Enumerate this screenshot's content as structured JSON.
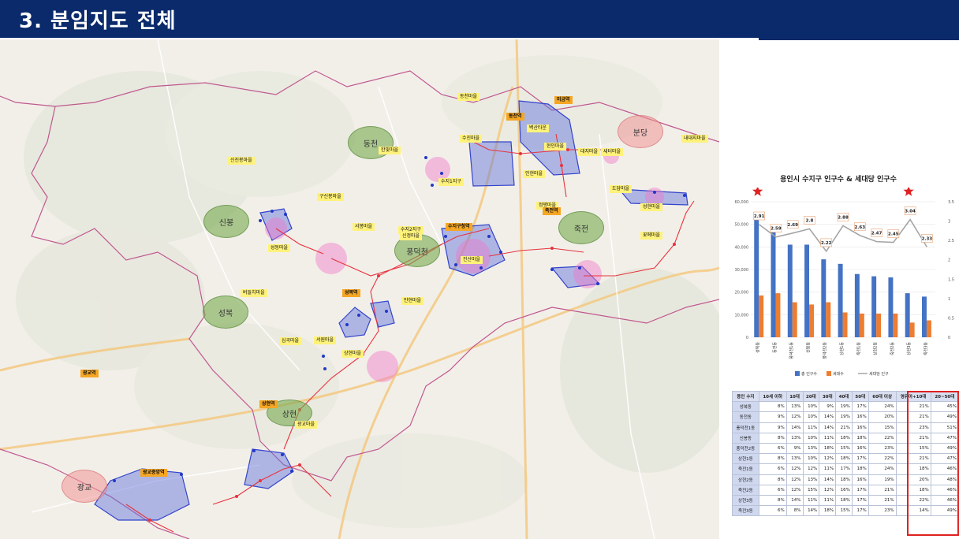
{
  "header": {
    "title": "3. 분임지도 전체"
  },
  "map": {
    "regions": [
      {
        "label": "동천",
        "color": "green"
      },
      {
        "label": "신봉",
        "color": "green"
      },
      {
        "label": "풍덕천",
        "color": "green"
      },
      {
        "label": "죽전",
        "color": "green"
      },
      {
        "label": "성복",
        "color": "green"
      },
      {
        "label": "상현",
        "color": "green"
      },
      {
        "label": "분당",
        "color": "pink"
      },
      {
        "label": "광교",
        "color": "pink"
      }
    ],
    "tags": [
      {
        "text": "동천마을",
        "style": "yellow"
      },
      {
        "text": "동천역",
        "style": "orange"
      },
      {
        "text": "미금역",
        "style": "orange"
      },
      {
        "text": "수진마을",
        "style": "yellow"
      },
      {
        "text": "한빛마을",
        "style": "yellow"
      },
      {
        "text": "벽산타운",
        "style": "yellow"
      },
      {
        "text": "현인마을",
        "style": "yellow"
      },
      {
        "text": "대지마을",
        "style": "yellow"
      },
      {
        "text": "내대지마을",
        "style": "yellow"
      },
      {
        "text": "새터마을",
        "style": "yellow"
      },
      {
        "text": "인현마을",
        "style": "yellow"
      },
      {
        "text": "도담마을",
        "style": "yellow"
      },
      {
        "text": "신진봉마을",
        "style": "yellow"
      },
      {
        "text": "구신봉마을",
        "style": "yellow"
      },
      {
        "text": "수지1지구",
        "style": "yellow"
      },
      {
        "text": "정평마을",
        "style": "yellow"
      },
      {
        "text": "죽전역",
        "style": "orange"
      },
      {
        "text": "성현마을",
        "style": "yellow"
      },
      {
        "text": "꽃메마을",
        "style": "yellow"
      },
      {
        "text": "서봉마을",
        "style": "yellow"
      },
      {
        "text": "수지2지구",
        "style": "yellow"
      },
      {
        "text": "신정마을",
        "style": "yellow"
      },
      {
        "text": "수지구청역",
        "style": "orange"
      },
      {
        "text": "진산마을",
        "style": "yellow"
      },
      {
        "text": "성동마을",
        "style": "yellow"
      },
      {
        "text": "버들치마을",
        "style": "yellow"
      },
      {
        "text": "성복역",
        "style": "orange"
      },
      {
        "text": "만현마을",
        "style": "yellow"
      },
      {
        "text": "심곡마을",
        "style": "yellow"
      },
      {
        "text": "서원마을",
        "style": "yellow"
      },
      {
        "text": "상현마을",
        "style": "yellow"
      },
      {
        "text": "광교역",
        "style": "orange"
      },
      {
        "text": "상현역",
        "style": "orange"
      },
      {
        "text": "광교마을",
        "style": "yellow"
      },
      {
        "text": "광교중앙역",
        "style": "orange"
      }
    ]
  },
  "chart_data": {
    "type": "bar",
    "title": "용인시 수지구 인구수 & 세대당 인구수",
    "categories": [
      "성복동",
      "동천동",
      "풍덕천1동",
      "신봉동",
      "풍덕천2동",
      "상현1동",
      "죽전1동",
      "상현2동",
      "죽전2동",
      "상현3동",
      "죽전3동"
    ],
    "series": [
      {
        "name": "총 인구수",
        "color": "#4472c4",
        "axis": "left",
        "values": [
          52000,
          46500,
          41000,
          41000,
          34500,
          32500,
          28000,
          27000,
          26500,
          19500,
          18000
        ]
      },
      {
        "name": "세대수",
        "color": "#ed7d31",
        "axis": "left",
        "values": [
          18500,
          19500,
          15500,
          14500,
          15500,
          11000,
          10500,
          10500,
          10500,
          6500,
          7500
        ]
      },
      {
        "name": "세대당 인구",
        "color": "#a5a5a5",
        "axis": "right",
        "values": [
          2.91,
          2.59,
          2.69,
          2.8,
          2.22,
          2.88,
          2.63,
          2.47,
          2.45,
          3.04,
          2.33
        ]
      }
    ],
    "line_labels": [
      "2.91",
      "2.59",
      "2.69",
      "2.8",
      "2.22",
      "2.88",
      "2.63",
      "2.47",
      "2.45",
      "3.04",
      "2.33"
    ],
    "ylim": [
      0,
      60000
    ],
    "y2lim": [
      0,
      3.5
    ],
    "yticks": [
      "0",
      "10,000",
      "20,000",
      "30,000",
      "40,000",
      "50,000",
      "60,000"
    ],
    "y2ticks": [
      "0",
      "0.5",
      "1",
      "1.5",
      "2",
      "2.5",
      "3",
      "3.5"
    ],
    "legend": [
      "총 인구수",
      "세대수",
      "세대당 인구"
    ],
    "legend_position": "bottom",
    "markers": [
      "star",
      "star"
    ]
  },
  "table": {
    "headers": [
      "용인 수지",
      "10세 이하",
      "10대",
      "20대",
      "30대",
      "40대",
      "50대",
      "60대 이상",
      "영유아+10대",
      "20~50대"
    ],
    "rows": [
      [
        "성복동",
        "8%",
        "13%",
        "10%",
        "9%",
        "19%",
        "17%",
        "24%",
        "21%",
        "45%"
      ],
      [
        "동천동",
        "9%",
        "12%",
        "10%",
        "14%",
        "19%",
        "16%",
        "20%",
        "21%",
        "49%"
      ],
      [
        "풍덕천1동",
        "9%",
        "14%",
        "11%",
        "14%",
        "21%",
        "16%",
        "15%",
        "23%",
        "51%"
      ],
      [
        "신봉동",
        "8%",
        "13%",
        "10%",
        "11%",
        "18%",
        "18%",
        "22%",
        "21%",
        "47%"
      ],
      [
        "풍덕천2동",
        "6%",
        "9%",
        "13%",
        "18%",
        "15%",
        "16%",
        "23%",
        "15%",
        "49%"
      ],
      [
        "상현1동",
        "8%",
        "13%",
        "10%",
        "12%",
        "18%",
        "17%",
        "22%",
        "21%",
        "47%"
      ],
      [
        "죽전1동",
        "6%",
        "12%",
        "12%",
        "11%",
        "17%",
        "18%",
        "24%",
        "18%",
        "46%"
      ],
      [
        "상현2동",
        "8%",
        "12%",
        "13%",
        "14%",
        "18%",
        "16%",
        "19%",
        "20%",
        "48%"
      ],
      [
        "죽전2동",
        "6%",
        "12%",
        "15%",
        "12%",
        "16%",
        "17%",
        "21%",
        "18%",
        "46%"
      ],
      [
        "상현3동",
        "8%",
        "14%",
        "11%",
        "11%",
        "18%",
        "17%",
        "21%",
        "22%",
        "46%"
      ],
      [
        "죽전3동",
        "6%",
        "8%",
        "14%",
        "18%",
        "15%",
        "17%",
        "23%",
        "14%",
        "49%"
      ]
    ]
  }
}
